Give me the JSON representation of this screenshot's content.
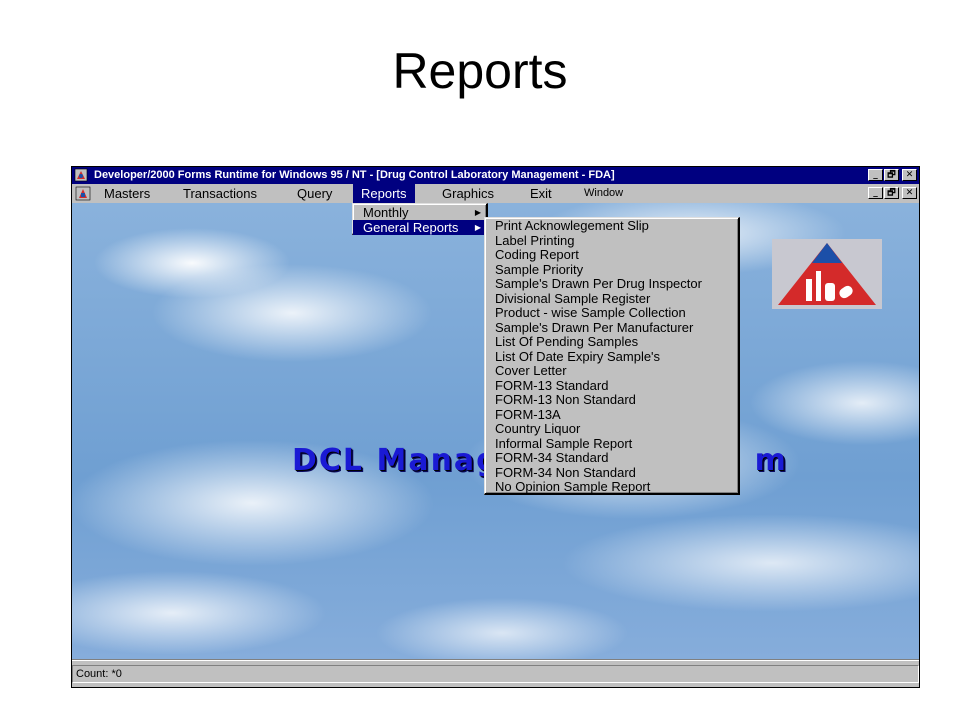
{
  "slide": {
    "title": "Reports"
  },
  "window": {
    "title": "Developer/2000 Forms Runtime for Windows 95 / NT - [Drug Control Laboratory Management - FDA]",
    "caption_buttons": {
      "minimize": "_",
      "maximize": "🗗",
      "close": "✕"
    }
  },
  "menubar": {
    "items": [
      "Masters",
      "Transactions",
      "Query",
      "Reports",
      "Graphics",
      "Exit",
      "Window"
    ],
    "active": "Reports"
  },
  "reports_menu": {
    "items": [
      {
        "label": "Monthly",
        "has_submenu": true
      },
      {
        "label": "General Reports",
        "has_submenu": true,
        "highlighted": true
      }
    ]
  },
  "general_reports_menu": {
    "items": [
      "Print Acknowlegement Slip",
      "Label Printing",
      "Coding Report",
      "Sample Priority",
      "Sample's Drawn Per Drug Inspector",
      "Divisional Sample Register",
      "Product - wise Sample Collection",
      "Sample's Drawn Per Manufacturer",
      "List Of Pending Samples",
      "List Of Date Expiry Sample's",
      "Cover Letter",
      "FORM-13 Standard",
      "FORM-13 Non Standard",
      "FORM-13A",
      "Country Liquor",
      "Informal Sample Report",
      "FORM-34 Standard",
      "FORM-34 Non Standard",
      "No Opinion Sample Report"
    ]
  },
  "banner": {
    "text": "DCL Manag",
    "suffix": "m"
  },
  "statusbar": {
    "text": "Count: *0"
  },
  "colors": {
    "titlebar": "#000080",
    "menu_highlight": "#000080",
    "chrome": "#c0c0c0",
    "banner": "#1a1ad4",
    "logo_red": "#d42a2a",
    "logo_blue": "#1c4fa8"
  }
}
